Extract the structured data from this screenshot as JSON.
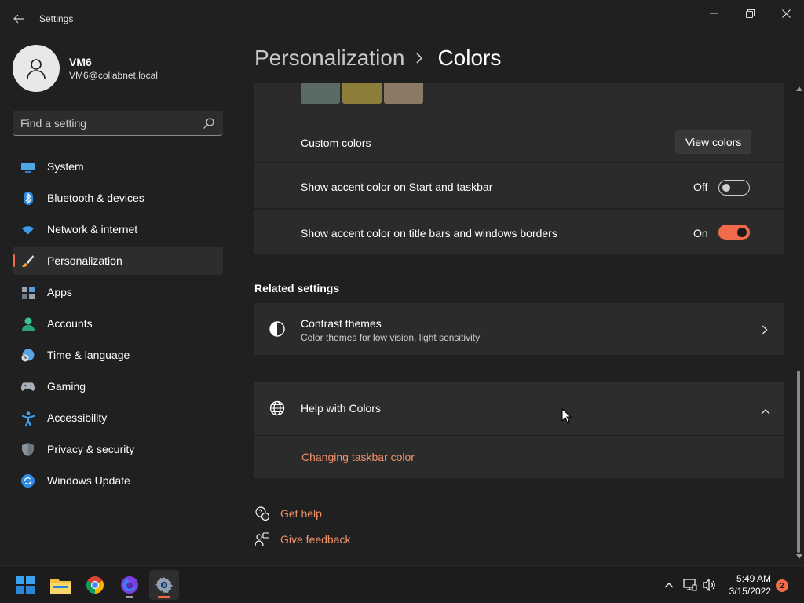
{
  "window": {
    "title": "Settings",
    "back_icon": "back-arrow-icon",
    "minimize_icon": "minimize-icon",
    "maximize_icon": "restore-icon",
    "close_icon": "close-icon"
  },
  "profile": {
    "name": "VM6",
    "email": "VM6@collabnet.local",
    "avatar_icon": "user-icon"
  },
  "search": {
    "placeholder": "Find a setting",
    "icon": "search-icon"
  },
  "sidebar": {
    "items": [
      {
        "label": "System",
        "icon": "monitor-icon",
        "active": false
      },
      {
        "label": "Bluetooth & devices",
        "icon": "bluetooth-icon",
        "active": false
      },
      {
        "label": "Network & internet",
        "icon": "wifi-icon",
        "active": false
      },
      {
        "label": "Personalization",
        "icon": "paintbrush-icon",
        "active": true
      },
      {
        "label": "Apps",
        "icon": "apps-icon",
        "active": false
      },
      {
        "label": "Accounts",
        "icon": "person-icon",
        "active": false
      },
      {
        "label": "Time & language",
        "icon": "clock-globe-icon",
        "active": false
      },
      {
        "label": "Gaming",
        "icon": "gamepad-icon",
        "active": false
      },
      {
        "label": "Accessibility",
        "icon": "accessibility-icon",
        "active": false
      },
      {
        "label": "Privacy & security",
        "icon": "shield-icon",
        "active": false
      },
      {
        "label": "Windows Update",
        "icon": "update-icon",
        "active": false
      }
    ]
  },
  "header": {
    "parent": "Personalization",
    "current": "Colors"
  },
  "colors": {
    "swatches": [
      "#5a6b64",
      "#8c7d3a",
      "#8a7a66"
    ],
    "custom_colors_label": "Custom colors",
    "view_colors_button": "View colors",
    "start_taskbar_label": "Show accent color on Start and taskbar",
    "start_taskbar_state": "Off",
    "title_bars_label": "Show accent color on title bars and windows borders",
    "title_bars_state": "On"
  },
  "related": {
    "title": "Related settings",
    "contrast_title": "Contrast themes",
    "contrast_subtitle": "Color themes for low vision, light sensitivity"
  },
  "help": {
    "title": "Help with Colors",
    "link": "Changing taskbar color"
  },
  "footer": {
    "get_help": "Get help",
    "give_feedback": "Give feedback"
  },
  "taskbar": {
    "apps": [
      "start-icon",
      "file-explorer-icon",
      "chrome-icon",
      "firefox-icon",
      "settings-icon"
    ],
    "time": "5:49 AM",
    "date": "3/15/2022",
    "notifications": "2"
  },
  "theme": {
    "accent": "#f16a4a",
    "link": "#f0916a",
    "background": "#202020",
    "card": "#2b2b2b"
  }
}
